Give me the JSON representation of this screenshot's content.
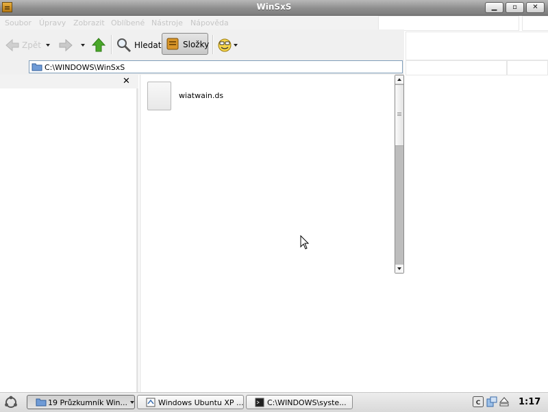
{
  "window": {
    "title": "WinSxS",
    "controls": {
      "minimize": "▁",
      "maximize": "▫",
      "close": "✕"
    }
  },
  "menu": [
    "Soubor",
    "Úpravy",
    "Zobrazit",
    "Oblíbené",
    "Nástroje",
    "Nápověda"
  ],
  "toolbar": {
    "back": "Zpět",
    "search": "Hledat",
    "folders": "Složky"
  },
  "address": {
    "path": "C:\\WINDOWS\\WinSxS"
  },
  "sidebar": {
    "close": "✕"
  },
  "files": [
    {
      "name": "wiatwain.ds",
      "icon": "generic-file-icon"
    }
  ],
  "taskbar": {
    "tasks": [
      {
        "label": "19 Průzkumník Win...",
        "icon": "folder-icon",
        "active": true
      },
      {
        "label": "Windows Ubuntu XP ...",
        "icon": "browser-icon",
        "active": false
      },
      {
        "label": "C:\\WINDOWS\\syste...",
        "icon": "terminal-icon",
        "active": false
      }
    ],
    "clock": "1:17"
  },
  "colors": {
    "titlebar": "#8e8e8e",
    "accent_green": "#4aa82a",
    "folder_blue": "#4f7fc3"
  }
}
